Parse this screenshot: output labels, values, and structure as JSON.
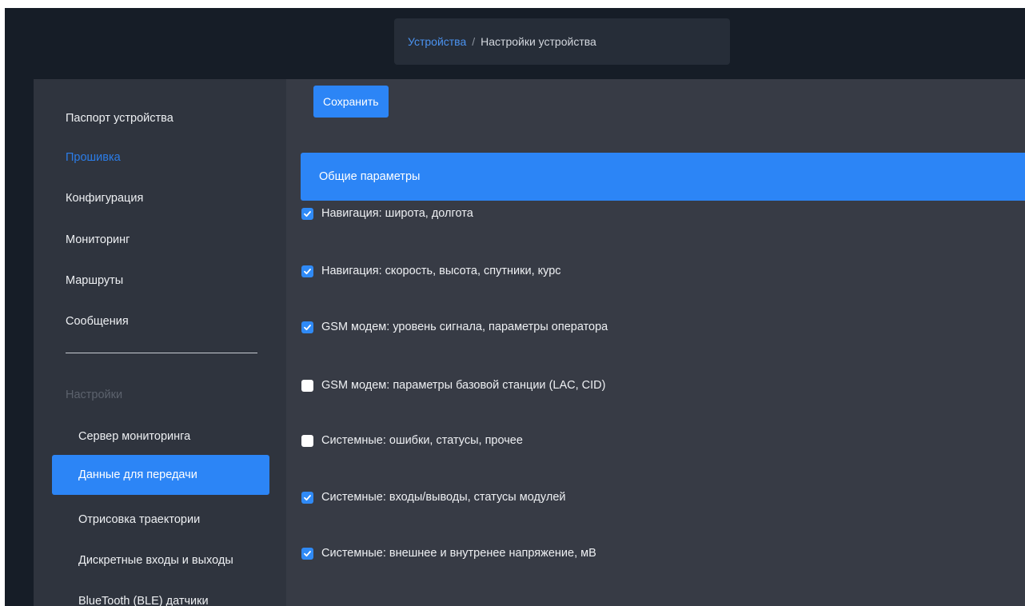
{
  "breadcrumb": {
    "parent": "Устройства",
    "separator": "/",
    "current": "Настройки устройства"
  },
  "sidebar": {
    "items": [
      {
        "label": "Паспорт устройства"
      },
      {
        "label": "Прошивка"
      },
      {
        "label": "Конфигурация"
      },
      {
        "label": "Мониторинг"
      },
      {
        "label": "Маршруты"
      },
      {
        "label": "Сообщения"
      }
    ],
    "settings_label": "Настройки",
    "settings_items": [
      {
        "label": "Сервер мониторинга"
      },
      {
        "label": "Данные для передачи"
      },
      {
        "label": "Отрисовка траектории"
      },
      {
        "label": "Дискретные входы и выходы"
      },
      {
        "label": "BlueTooth (BLE) датчики"
      }
    ]
  },
  "main": {
    "save_label": "Сохранить",
    "group_title": "Общие параметры",
    "options": [
      {
        "label": "Навигация: широта, долгота",
        "checked": true
      },
      {
        "label": "Навигация: скорость, высота, спутники, курс",
        "checked": true
      },
      {
        "label": "GSM модем: уровень сигнала, параметры оператора",
        "checked": true
      },
      {
        "label": "GSM модем: параметры базовой станции (LAC, CID)",
        "checked": false
      },
      {
        "label": "Системные: ошибки, статусы, прочее",
        "checked": false
      },
      {
        "label": "Системные: входы/выводы, статусы модулей",
        "checked": true
      },
      {
        "label": "Системные: внешнее и внутренее напряжение, мВ",
        "checked": true
      }
    ]
  },
  "colors": {
    "accent": "#2c85f6",
    "link": "#4b93f0",
    "background": "#161d27",
    "sidebar": "#2f343e",
    "content": "#373b45"
  },
  "icons": {
    "checkbox_checked": "checkbox-checked-icon",
    "checkbox_unchecked": "checkbox-unchecked-icon"
  }
}
